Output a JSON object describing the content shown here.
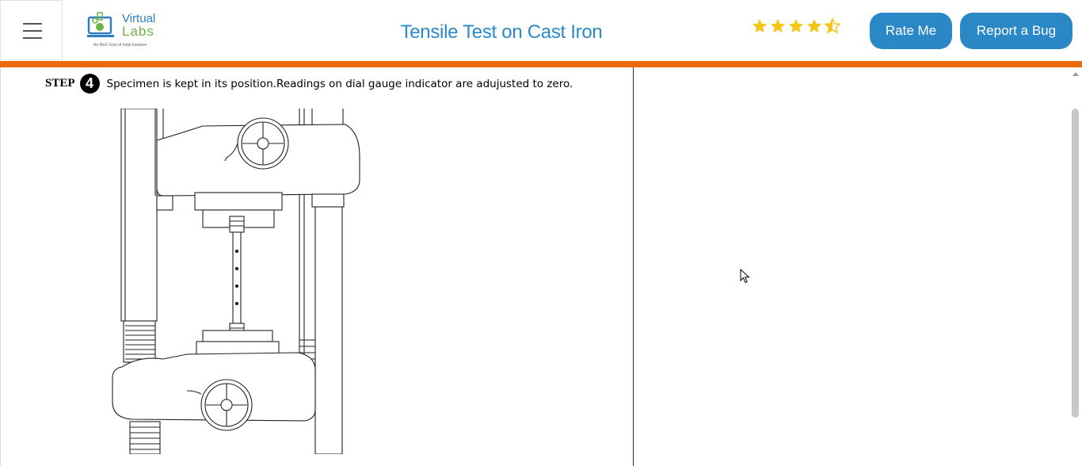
{
  "header": {
    "menu_icon": "hamburger-icon",
    "logo": {
      "line1": "Virtual",
      "line2": "Labs",
      "tagline": "An MoE Govt of India Initiative"
    },
    "title": "Tensile Test on Cast Iron",
    "rating": {
      "value": 4.5,
      "max": 5,
      "color": "#f5c518"
    },
    "rate_button": "Rate Me",
    "bug_button": "Report a Bug"
  },
  "colors": {
    "accent": "#2a88c6",
    "title": "#2b8ac9",
    "bar": "#ec6a0b"
  },
  "step": {
    "label": "STEP",
    "number": "4",
    "text": "Specimen is kept in its position.Readings on dial gauge indicator are adujusted to zero."
  },
  "illustration": "utm-machine-with-specimen"
}
